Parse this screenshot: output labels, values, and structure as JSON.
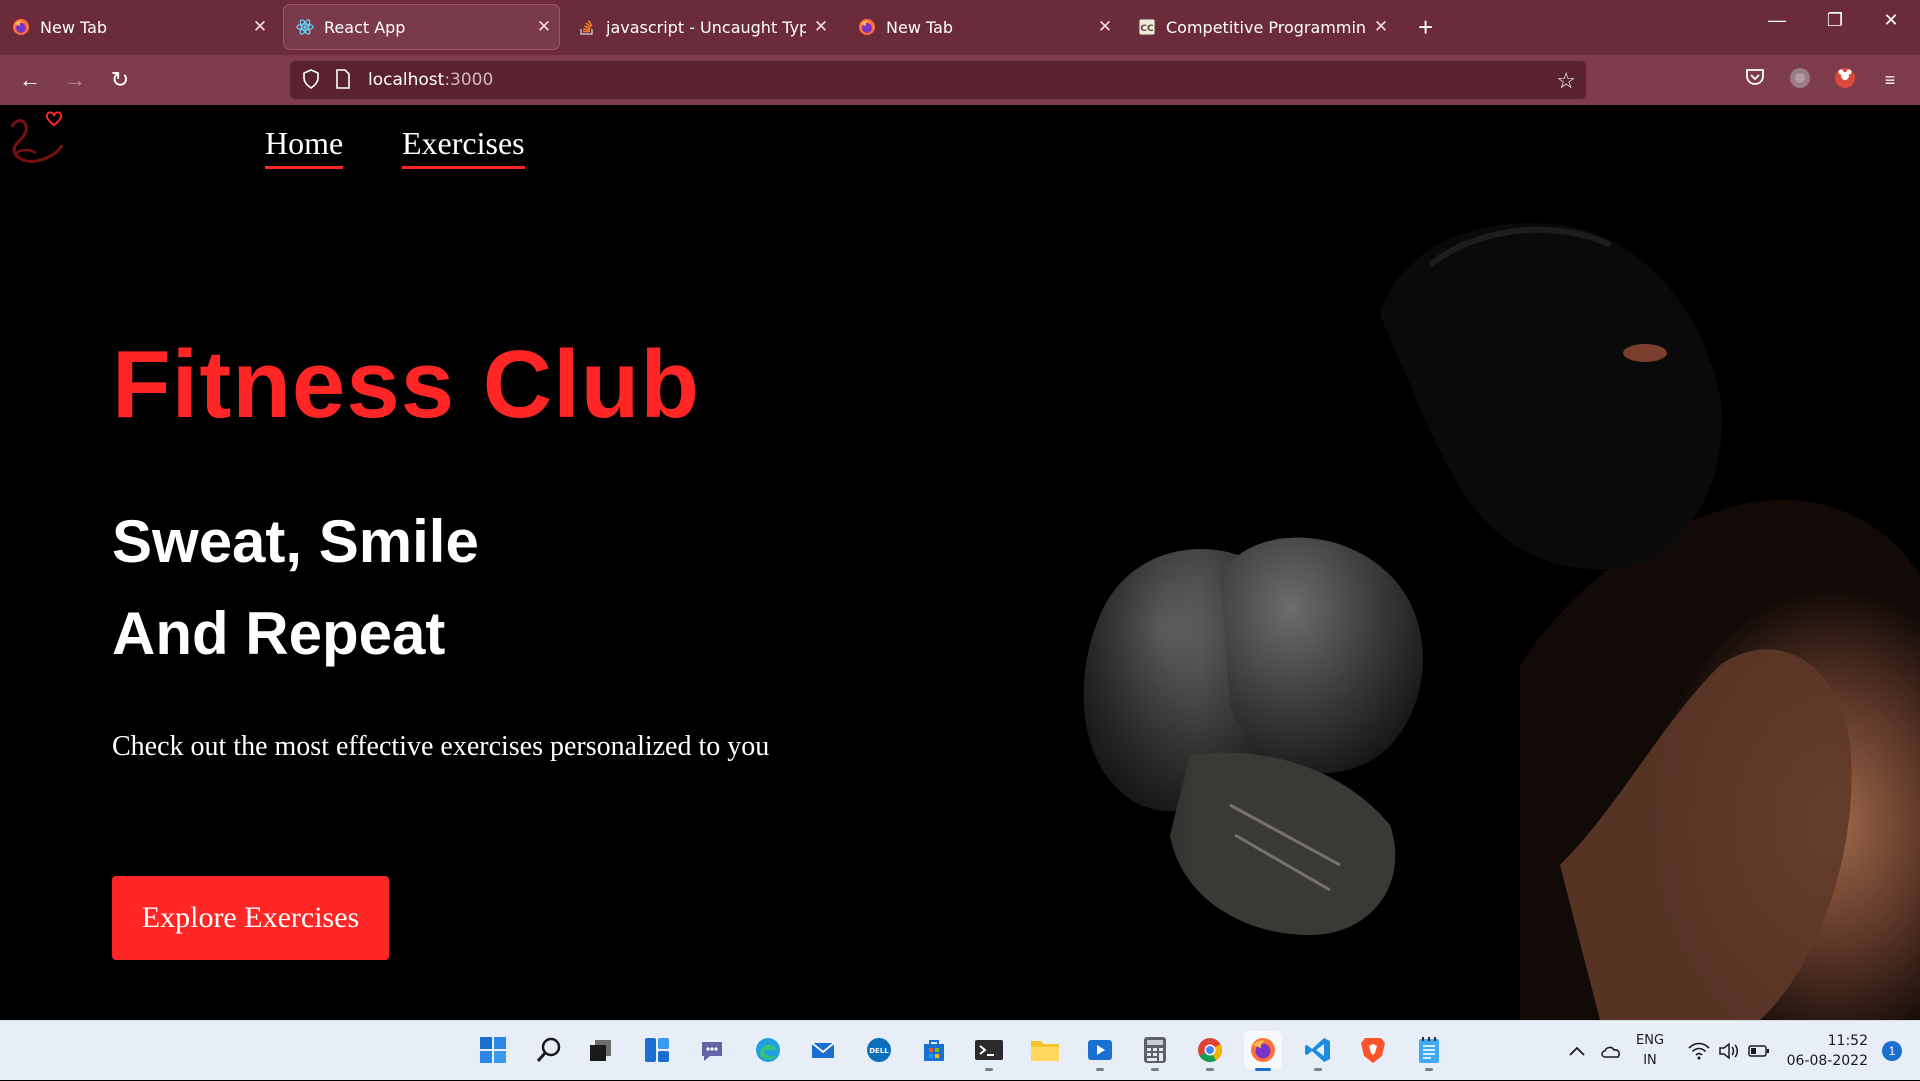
{
  "browser": {
    "tabs": [
      {
        "title": "New Tab",
        "icon": "firefox-icon"
      },
      {
        "title": "React App",
        "icon": "react-icon",
        "active": true
      },
      {
        "title": "javascript - Uncaught TypeError",
        "icon": "stackoverflow-icon"
      },
      {
        "title": "New Tab",
        "icon": "firefox-icon"
      },
      {
        "title": "Competitive Programming | Par",
        "icon": "codechef-icon"
      }
    ],
    "url_host": "localhost",
    "url_port": ":3000",
    "accent": "#6b2b3b"
  },
  "site": {
    "nav": {
      "home": "Home",
      "exercises": "Exercises"
    },
    "hero": {
      "title": "Fitness Club",
      "line1": "Sweat, Smile",
      "line2": "And Repeat",
      "description": "Check out the most effective exercises personalized to you",
      "button": "Explore Exercises"
    },
    "accent": "#ff2625"
  },
  "taskbar": {
    "lang_top": "ENG",
    "lang_bottom": "IN",
    "time": "11:52",
    "date": "06-08-2022",
    "notifications": "1"
  }
}
